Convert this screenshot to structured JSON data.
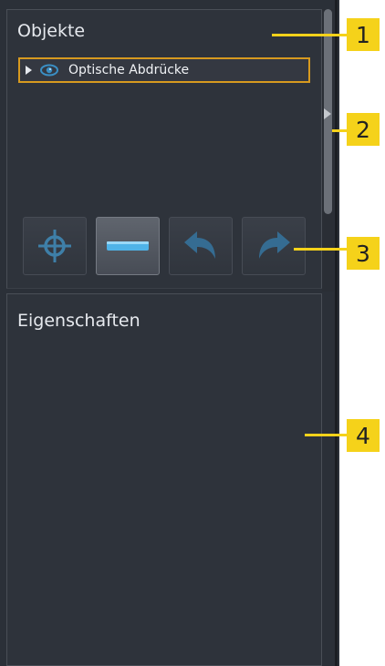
{
  "objects_panel": {
    "title": "Objekte",
    "tree_item": {
      "label": "Optische Abdrücke",
      "expanded": false,
      "visible": true
    }
  },
  "toolbar": {
    "buttons": [
      {
        "name": "focus",
        "icon": "crosshair-icon",
        "active": false
      },
      {
        "name": "flatten",
        "icon": "horizontal-bar-icon",
        "active": true
      },
      {
        "name": "undo",
        "icon": "undo-arrow-icon",
        "active": false
      },
      {
        "name": "redo",
        "icon": "redo-arrow-icon",
        "active": false
      }
    ]
  },
  "properties_panel": {
    "title": "Eigenschaften"
  },
  "callouts": [
    "1",
    "2",
    "3",
    "4"
  ],
  "colors": {
    "panel_bg": "#2e333b",
    "selection_border": "#d79a1f",
    "icon_blue": "#3a8fc4",
    "callout_yellow": "#f5d21a"
  }
}
